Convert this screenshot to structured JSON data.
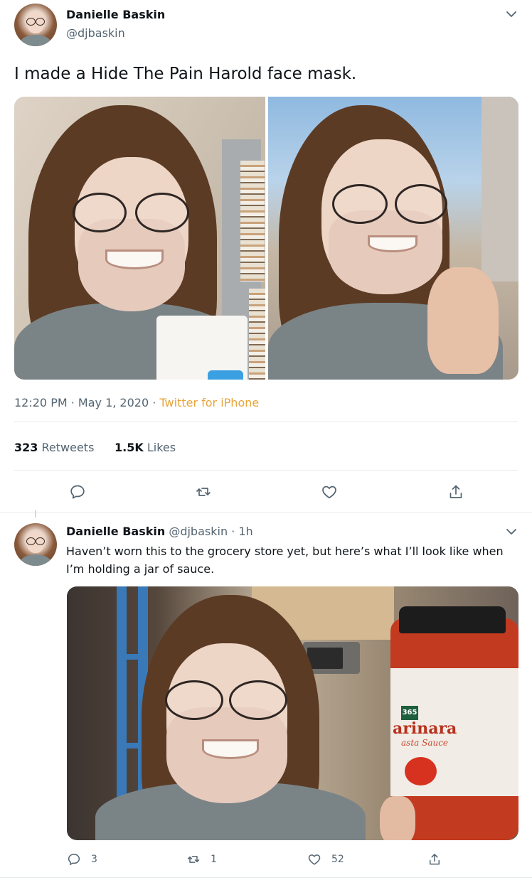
{
  "main_tweet": {
    "author_name": "Danielle Baskin",
    "author_handle": "@djbaskin",
    "text": "I made a Hide The Pain Harold face mask.",
    "timestamp": "12:20 PM · May 1, 2020",
    "separator": " · ",
    "source": "Twitter for iPhone",
    "retweets_count": "323",
    "retweets_label": "Retweets",
    "likes_count": "1.5K",
    "likes_label": "Likes",
    "actions": [
      "reply-icon",
      "retweet-icon",
      "like-icon",
      "share-icon"
    ]
  },
  "reply_tweet": {
    "author_name": "Danielle Baskin",
    "author_handle": "@djbaskin",
    "time_ago": "1h",
    "separator": "·",
    "text": "Haven’t worn this to the grocery store yet, but here’s what I’ll look like when I’m holding a jar of sauce.",
    "image_label_brand": "365",
    "image_label_product": "arinara",
    "image_label_sub": "asta Sauce",
    "reply_count": "3",
    "retweet_count": "1",
    "like_count": "52"
  },
  "colors": {
    "text_primary": "#0f1419",
    "text_secondary": "#536471",
    "source_link": "#e8a43a",
    "divider": "#e7ecef"
  }
}
